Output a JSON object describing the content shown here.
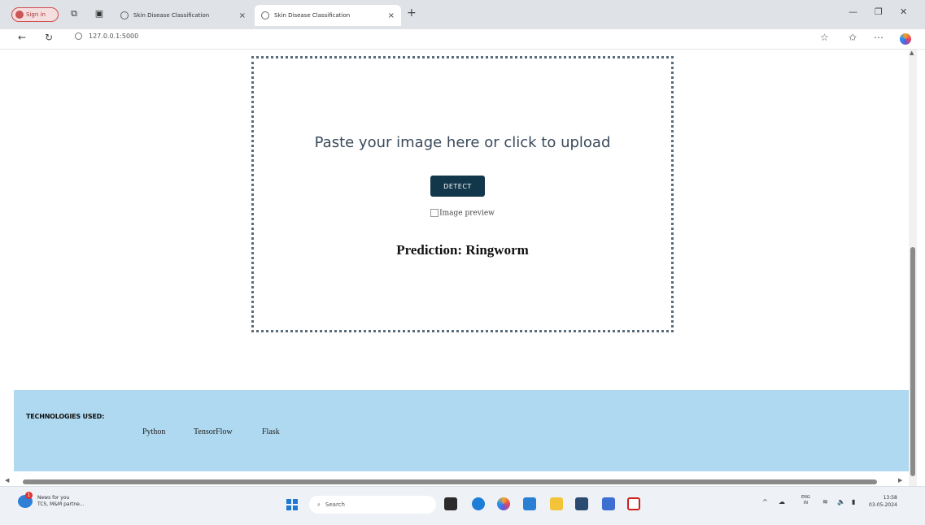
{
  "browser": {
    "signin_label": "Sign in",
    "tabs": [
      {
        "title": "Skin Disease Classification",
        "active": false
      },
      {
        "title": "Skin Disease Classification",
        "active": true
      }
    ],
    "url": "127.0.0.1:5000"
  },
  "upload": {
    "prompt": "Paste your image here or click to upload",
    "detect_label": "DETECT",
    "preview_alt": "Image preview",
    "prediction": "Prediction: Ringworm"
  },
  "footer": {
    "title": "TECHNOLOGIES USED:",
    "items": [
      "Python",
      "TensorFlow",
      "Flask"
    ]
  },
  "taskbar": {
    "news_line1": "News for you",
    "news_line2": "TCS, M&M partne...",
    "news_badge": "1",
    "search_placeholder": "Search",
    "lang_line1": "ENG",
    "lang_line2": "IN",
    "time": "13:58",
    "date": "03-05-2024"
  },
  "colors": {
    "detect_button": "#12364a",
    "footer_bg": "#afd9f0"
  }
}
